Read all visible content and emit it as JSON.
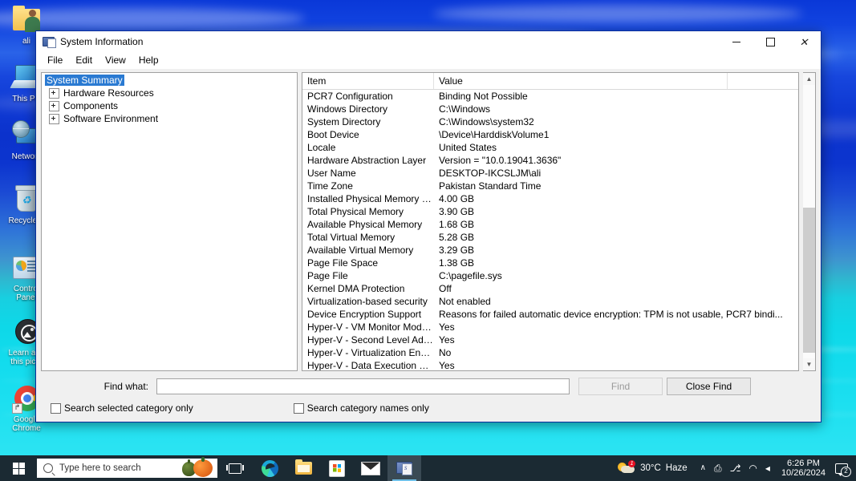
{
  "desktop": {
    "icons": [
      {
        "name": "ali",
        "label": "ali"
      },
      {
        "name": "this-pc",
        "label": "This PC"
      },
      {
        "name": "network",
        "label": "Network"
      },
      {
        "name": "recycle-bin",
        "label": "Recycle B..."
      },
      {
        "name": "control-panel",
        "label": "Control\nPanel"
      },
      {
        "name": "learn-about-picture",
        "label": "Learn abo\nthis pictu"
      },
      {
        "name": "google-chrome",
        "label": "Google\nChrome"
      }
    ],
    "icon_labels": {
      "ali": "ali",
      "this_pc": "This PC",
      "network": "Network",
      "recycle_bin": "Recycle B",
      "control_panel_line1": "Control",
      "control_panel_line2": "Panel",
      "learn_line1": "Learn abo",
      "learn_line2": "this pictu",
      "chrome_line1": "Google",
      "chrome_line2": "Chrome",
      "chrome_shortcut_glyph": "↱"
    }
  },
  "window": {
    "title": "System Information",
    "controls": {
      "minimize": "–",
      "maximize": "□",
      "close": "✕"
    },
    "menu": [
      "File",
      "Edit",
      "View",
      "Help"
    ]
  },
  "tree": {
    "items": [
      {
        "label": "System Summary",
        "selected": true,
        "expandable": false
      },
      {
        "label": "Hardware Resources",
        "selected": false,
        "expandable": true
      },
      {
        "label": "Components",
        "selected": false,
        "expandable": true
      },
      {
        "label": "Software Environment",
        "selected": false,
        "expandable": true
      }
    ]
  },
  "list": {
    "headers": [
      "Item",
      "Value"
    ],
    "rows": [
      {
        "item": "PCR7 Configuration",
        "value": "Binding Not Possible"
      },
      {
        "item": "Windows Directory",
        "value": "C:\\Windows"
      },
      {
        "item": "System Directory",
        "value": "C:\\Windows\\system32"
      },
      {
        "item": "Boot Device",
        "value": "\\Device\\HarddiskVolume1"
      },
      {
        "item": "Locale",
        "value": "United States"
      },
      {
        "item": "Hardware Abstraction Layer",
        "value": "Version = \"10.0.19041.3636\""
      },
      {
        "item": "User Name",
        "value": "DESKTOP-IKCSLJM\\ali"
      },
      {
        "item": "Time Zone",
        "value": "Pakistan Standard Time"
      },
      {
        "item": "Installed Physical Memory (RAM)",
        "value": "4.00 GB"
      },
      {
        "item": "Total Physical Memory",
        "value": "3.90 GB"
      },
      {
        "item": "Available Physical Memory",
        "value": "1.68 GB"
      },
      {
        "item": "Total Virtual Memory",
        "value": "5.28 GB"
      },
      {
        "item": "Available Virtual Memory",
        "value": "3.29 GB"
      },
      {
        "item": "Page File Space",
        "value": "1.38 GB"
      },
      {
        "item": "Page File",
        "value": "C:\\pagefile.sys"
      },
      {
        "item": "Kernel DMA Protection",
        "value": "Off"
      },
      {
        "item": "Virtualization-based security",
        "value": "Not enabled"
      },
      {
        "item": "Device Encryption Support",
        "value": "Reasons for failed automatic device encryption: TPM is not usable, PCR7 bindi..."
      },
      {
        "item": "Hyper-V - VM Monitor Mode E...",
        "value": "Yes"
      },
      {
        "item": "Hyper-V - Second Level Addres...",
        "value": "Yes"
      },
      {
        "item": "Hyper-V - Virtualization Enable...",
        "value": "No"
      },
      {
        "item": "Hyper-V - Data Execution Prote...",
        "value": "Yes"
      }
    ],
    "scroll": {
      "up_glyph": "▲",
      "down_glyph": "▼"
    }
  },
  "find": {
    "label": "Find what:",
    "input_value": "",
    "input_placeholder": "",
    "find_button": "Find",
    "close_button": "Close Find",
    "checkbox_selected_category": "Search selected category only",
    "checkbox_category_names": "Search category names only"
  },
  "taskbar": {
    "search_placeholder": "Type here to search",
    "weather_temp": "30°C",
    "weather_condition": "Haze",
    "weather_badge": "1",
    "clock_time": "6:26 PM",
    "clock_date": "10/26/2024",
    "notification_count": "2",
    "tray": {
      "chevron": "∧",
      "onedrive": "⎙",
      "usb": "⎇",
      "wifi": "◠",
      "volume": "◂"
    },
    "apps": [
      {
        "name": "microsoft-edge",
        "active": false
      },
      {
        "name": "file-explorer",
        "active": false
      },
      {
        "name": "microsoft-store",
        "active": false
      },
      {
        "name": "mail",
        "active": false
      },
      {
        "name": "system-information",
        "active": true
      }
    ]
  },
  "colors": {
    "accent": "#2a7ad2",
    "taskbar_bg": "#1b2a33",
    "window_bg": "#f0f0f0",
    "badge_red": "#e81123"
  }
}
